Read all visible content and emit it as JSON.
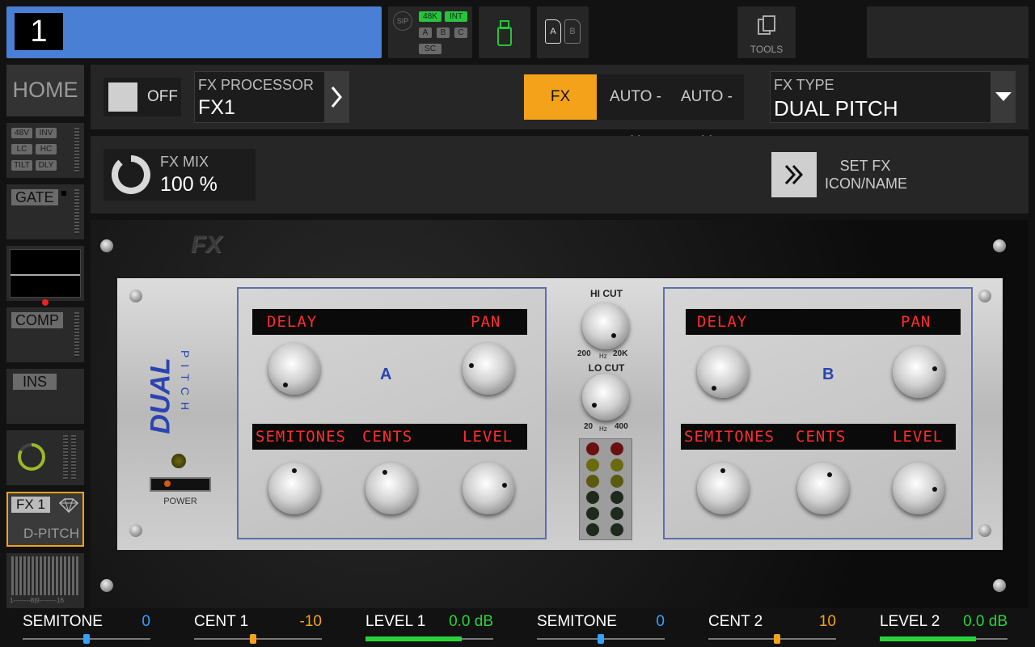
{
  "channel": {
    "number": "1"
  },
  "status": {
    "sip": "SIP",
    "rate": "48K",
    "clock": "INT",
    "inputs": [
      "A",
      "B",
      "C"
    ],
    "sc": "SC",
    "card_a": "A",
    "card_b": "B",
    "tools_label": "TOOLS"
  },
  "rail": {
    "home": "HOME",
    "preamp_tags": [
      "48V",
      "INV",
      "LC",
      "HC",
      "TILT",
      "DLY"
    ],
    "gate": "GATE",
    "comp": "COMP",
    "ins": "INS",
    "fx_label": "FX 1",
    "fx_name": "D-PITCH",
    "meter_scale": "1--------8|9--------16"
  },
  "header": {
    "toggle_label": "OFF",
    "processor_label": "FX PROCESSOR",
    "processor_value": "FX1",
    "tabs": [
      "FX",
      "AUTO - X",
      "AUTO - Y"
    ],
    "fx_type_label": "FX TYPE",
    "fx_type_value": "DUAL PITCH",
    "mix_label": "FX MIX",
    "mix_value": "100 %",
    "set_fx_line1": "SET FX",
    "set_fx_line2": "ICON/NAME"
  },
  "device": {
    "badge": "FX",
    "brand": "DUAL",
    "brand_sub": "PITCH",
    "power_label": "POWER",
    "channel_a": "A",
    "channel_b": "B",
    "lcd_delay": "DELAY",
    "lcd_pan": "PAN",
    "lcd_semitones": "SEMITONES",
    "lcd_cents": "CENTS",
    "lcd_level": "LEVEL",
    "hicut_label": "HI CUT",
    "hicut_min": "200",
    "hicut_unit": "Hz",
    "hicut_max": "20K",
    "locut_label": "LO CUT",
    "locut_min": "20",
    "locut_unit": "Hz",
    "locut_max": "400"
  },
  "sliders": [
    {
      "label": "SEMITONE",
      "value": "0",
      "color": "#2fa3ff",
      "position": 0.5
    },
    {
      "label": "CENT 1",
      "value": "-10",
      "color": "#f5a21b",
      "position": 0.46
    },
    {
      "label": "LEVEL 1",
      "value": "0.0 dB",
      "color": "#28d43a",
      "position": 0.75
    },
    {
      "label": "SEMITONE",
      "value": "0",
      "color": "#2fa3ff",
      "position": 0.5
    },
    {
      "label": "CENT 2",
      "value": "10",
      "color": "#f5a21b",
      "position": 0.54
    },
    {
      "label": "LEVEL 2",
      "value": "0.0 dB",
      "color": "#28d43a",
      "position": 0.75
    }
  ],
  "colors": {
    "accent": "#f5a21b",
    "channel": "#4a7fd6",
    "lcd_text": "#ff2b2b",
    "brand": "#2a44b0"
  }
}
